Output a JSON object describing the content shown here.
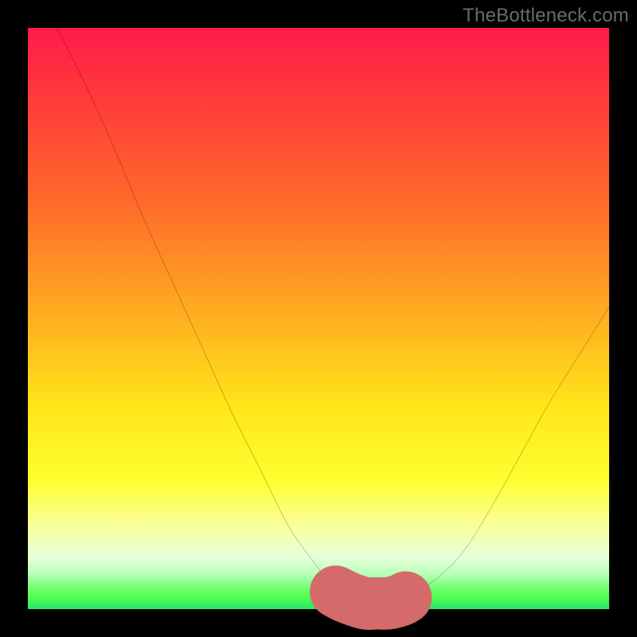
{
  "watermark": "TheBottleneck.com",
  "chart_data": {
    "type": "line",
    "title": "",
    "xlabel": "",
    "ylabel": "",
    "xlim": [
      0,
      100
    ],
    "ylim": [
      0,
      100
    ],
    "grid": false,
    "gradient": {
      "top_color": "#ff1b4a",
      "mid_color": "#ffe518",
      "bottom_color": "#29e36a",
      "description": "Vertical gradient: red (high bottleneck) at top fading through orange and yellow to green (no bottleneck) at bottom"
    },
    "series": [
      {
        "name": "bottleneck-curve",
        "color": "#000000",
        "x": [
          5,
          10,
          15,
          20,
          25,
          30,
          35,
          40,
          45,
          50,
          53,
          55,
          58,
          62,
          65,
          70,
          75,
          80,
          85,
          90,
          95,
          100
        ],
        "y": [
          100,
          90,
          79,
          67,
          56,
          45,
          34,
          24,
          14,
          7,
          3,
          2,
          1,
          1,
          2,
          5,
          10,
          18,
          27,
          36,
          44,
          52
        ]
      },
      {
        "name": "optimal-zone-highlight",
        "color": "#d46a6a",
        "stroke_width_px": 9,
        "x": [
          53,
          55,
          58,
          60,
          62,
          64,
          65
        ],
        "y": [
          3,
          2,
          1,
          1,
          1,
          1.5,
          2
        ]
      }
    ],
    "annotations": []
  }
}
